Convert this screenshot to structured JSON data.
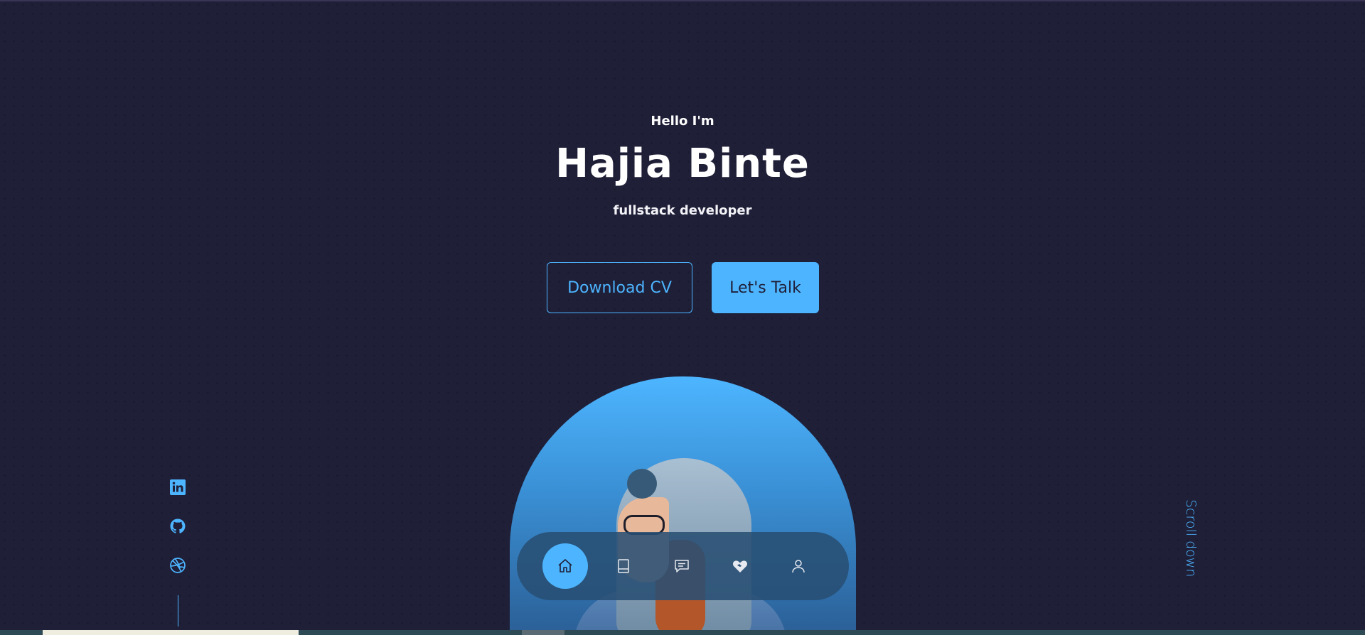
{
  "hero": {
    "greeting": "Hello I'm",
    "name": "Hajia Binte",
    "role": "fullstack developer"
  },
  "actions": {
    "download_cv": "Download CV",
    "lets_talk": "Let's Talk"
  },
  "nav": {
    "items": [
      {
        "icon": "home-icon",
        "active": true
      },
      {
        "icon": "book-icon",
        "active": false
      },
      {
        "icon": "message-icon",
        "active": false
      },
      {
        "icon": "heart-handshake-icon",
        "active": false
      },
      {
        "icon": "user-icon",
        "active": false
      }
    ]
  },
  "socials": [
    {
      "icon": "linkedin-icon"
    },
    {
      "icon": "github-icon"
    },
    {
      "icon": "dribbble-icon"
    }
  ],
  "scroll_down": "Scroll down",
  "colors": {
    "background": "#1f1f38",
    "accent": "#4db5ff",
    "text": "#ffffff"
  }
}
